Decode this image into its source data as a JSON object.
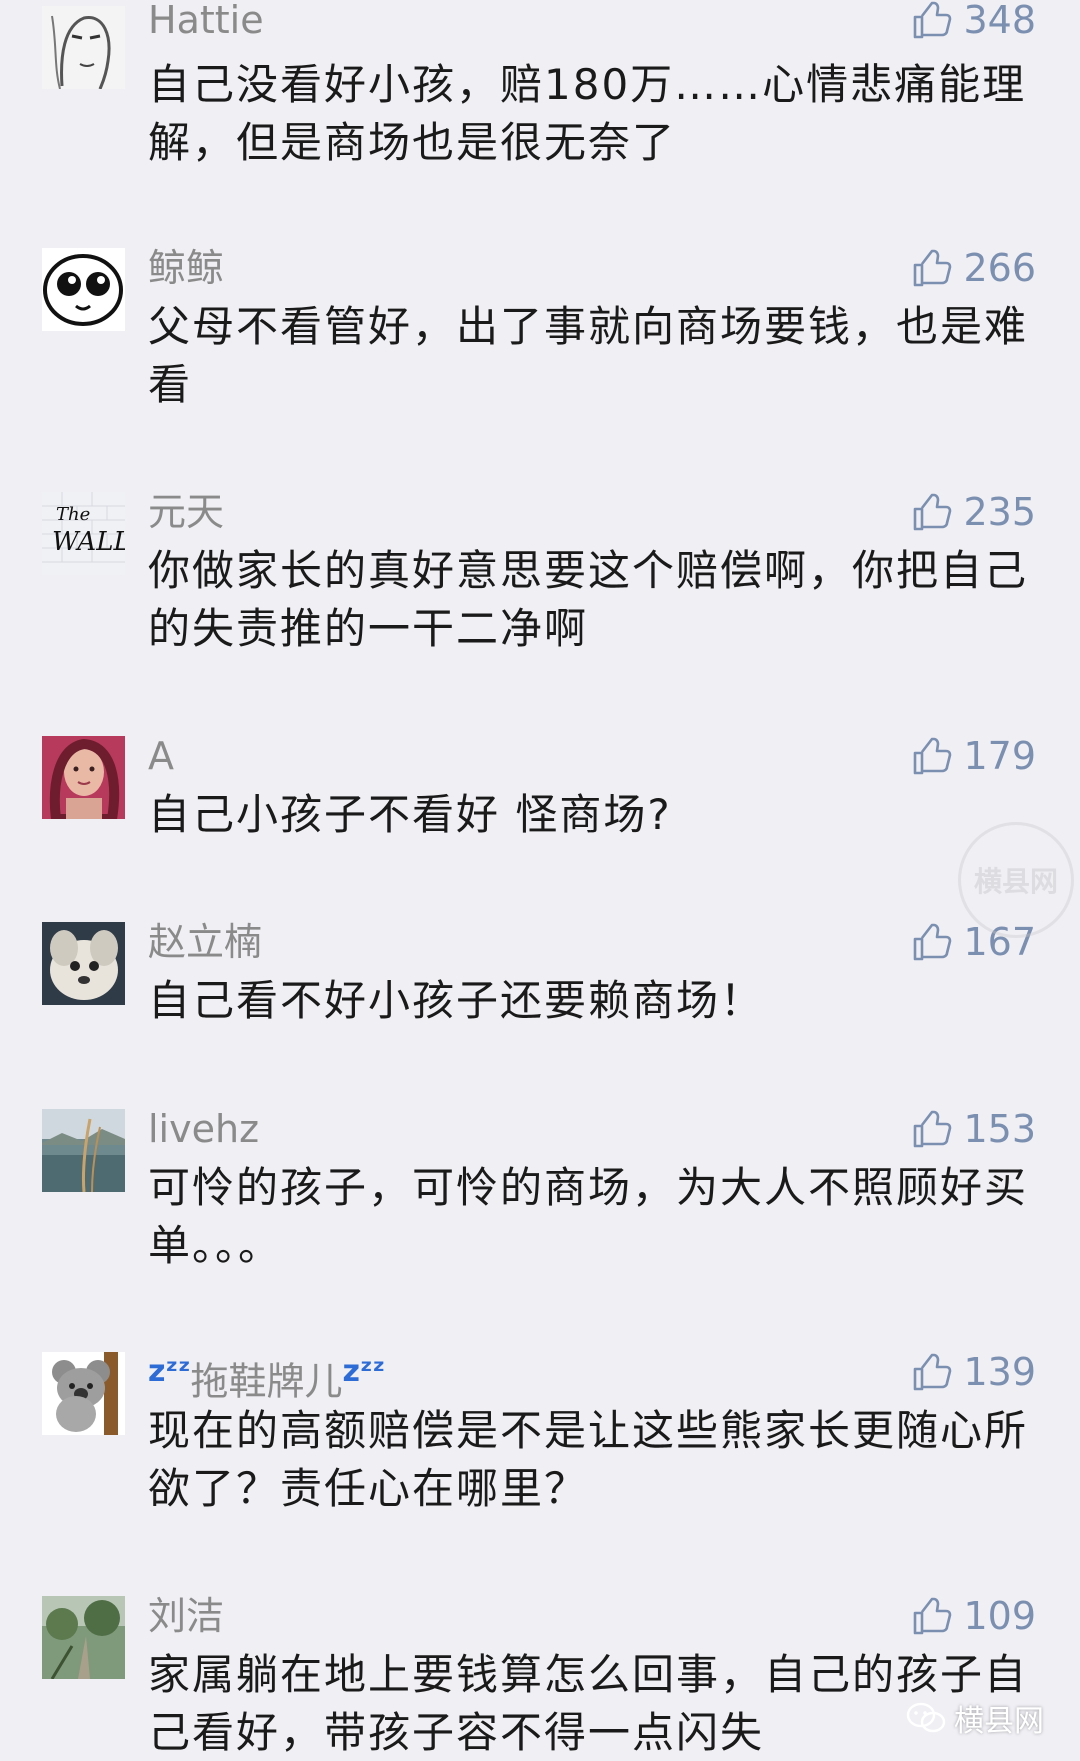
{
  "comments": [
    {
      "name": "Hattie",
      "likes": "348",
      "text": "自己没看好小孩，赔180万……心情悲痛能理解，但是商场也是很无奈了"
    },
    {
      "name": "鲸鲸",
      "likes": "266",
      "text": "父母不看管好，出了事就向商场要钱，也是难看"
    },
    {
      "name": "元天",
      "likes": "235",
      "text": "你做家长的真好意思要这个赔偿啊，你把自己的失责推的一干二净啊"
    },
    {
      "name": "A",
      "likes": "179",
      "text": "自己小孩子不看好 怪商场?"
    },
    {
      "name": "赵立楠",
      "likes": "167",
      "text": "自己看不好小孩子还要赖商场！"
    },
    {
      "name": "livehz",
      "likes": "153",
      "text": "可怜的孩子，可怜的商场，为大人不照顾好买单。。。"
    },
    {
      "name": "拖鞋牌儿",
      "name_decoration": "zᶻᶻ",
      "likes": "139",
      "text": "现在的高额赔偿是不是让这些熊家长更随心所欲了？责任心在哪里？"
    },
    {
      "name": "刘洁",
      "likes": "109",
      "text": "家属躺在地上要钱算怎么回事，自己的孩子自己看好，带孩子容不得一点闪失"
    }
  ],
  "watermark": {
    "text": "横县网"
  },
  "seal": {
    "text": "横县网"
  },
  "icons": {
    "like": "thumbs-up-icon"
  },
  "colors": {
    "likes": "#7b8fb0",
    "name": "#8a8a8a",
    "background": "#efeff4"
  }
}
